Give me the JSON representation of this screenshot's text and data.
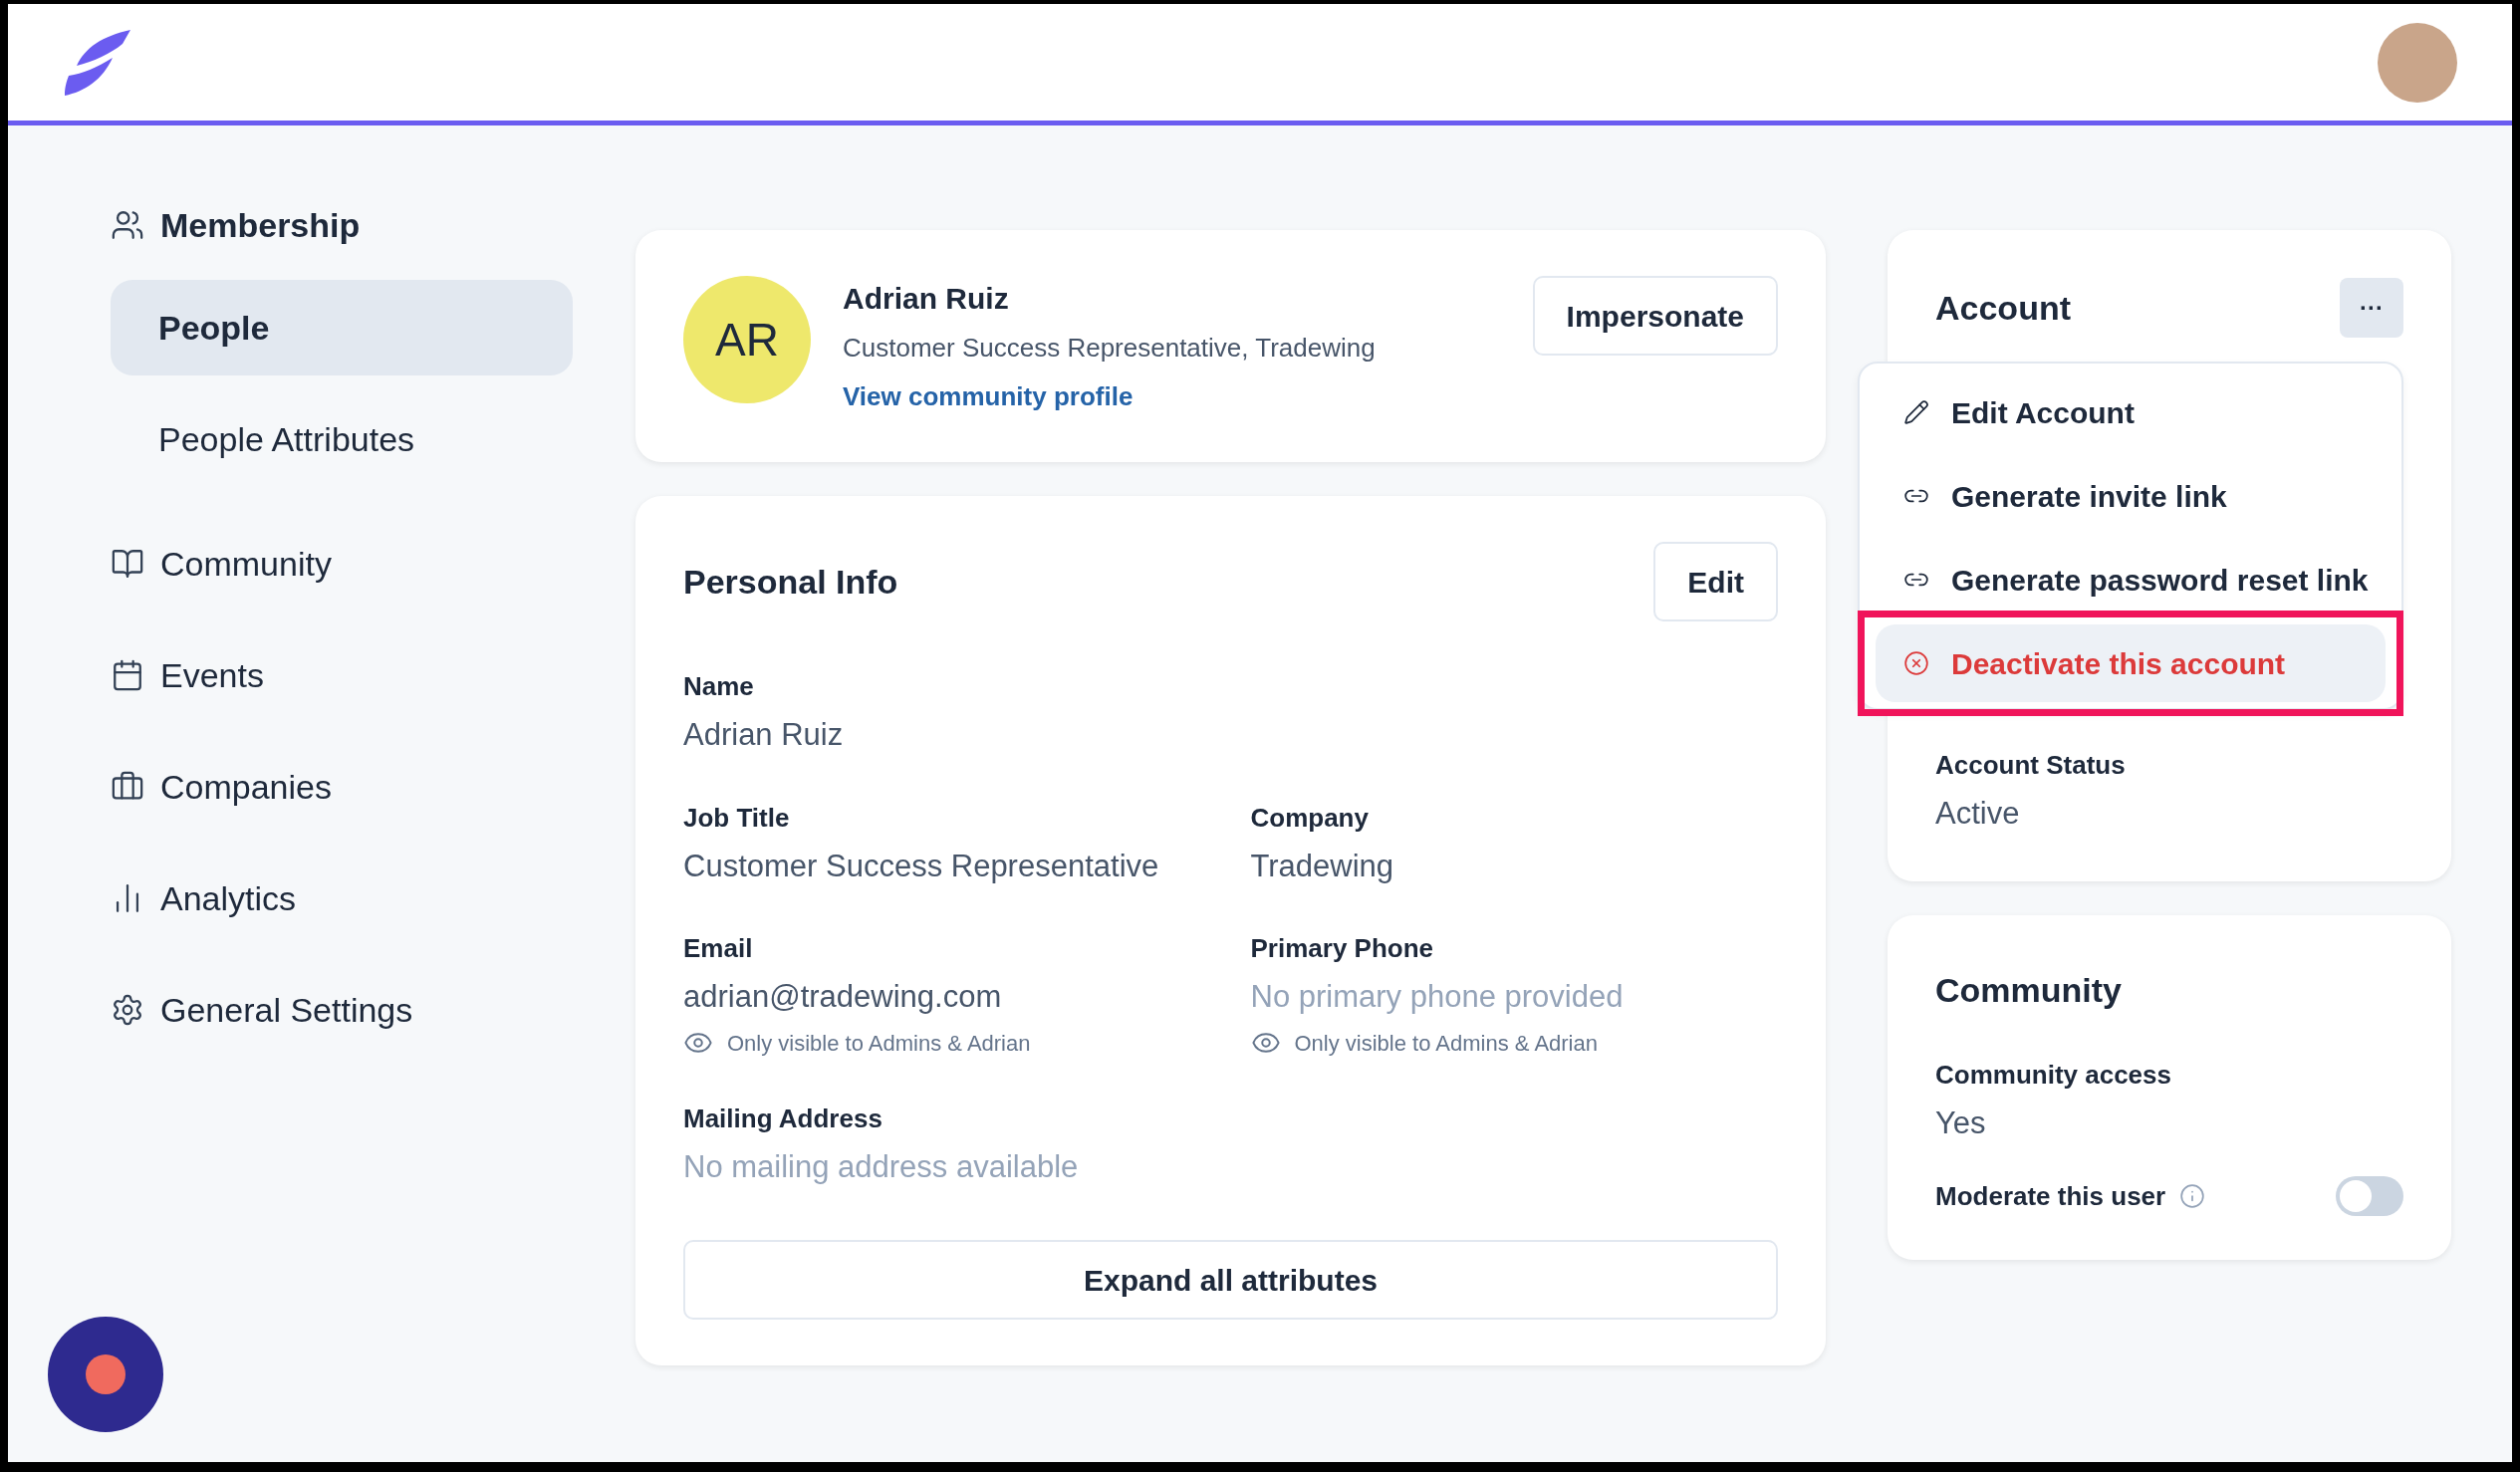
{
  "sidebar": {
    "items": [
      {
        "label": "Membership",
        "selected": false,
        "children": [
          {
            "label": "People",
            "selected": true
          },
          {
            "label": "People Attributes",
            "selected": false
          }
        ]
      },
      {
        "label": "Community",
        "selected": false
      },
      {
        "label": "Events",
        "selected": false
      },
      {
        "label": "Companies",
        "selected": false
      },
      {
        "label": "Analytics",
        "selected": false
      },
      {
        "label": "General Settings",
        "selected": false
      }
    ]
  },
  "profile": {
    "initials": "AR",
    "name": "Adrian Ruiz",
    "subtitle": "Customer Success Representative, Tradewing",
    "link": "View community profile",
    "button": "Impersonate"
  },
  "personal_info": {
    "title": "Personal Info",
    "edit_button": "Edit",
    "rows": [
      [
        {
          "label": "Name",
          "value": "Adrian Ruiz",
          "empty": false
        }
      ],
      [
        {
          "label": "Job Title",
          "value": "Customer Success Representative",
          "empty": false
        },
        {
          "label": "Company",
          "value": "Tradewing",
          "empty": false
        }
      ],
      [
        {
          "label": "Email",
          "value": "adrian@tradewing.com",
          "empty": false,
          "note": "Only visible to Admins & Adrian"
        },
        {
          "label": "Primary Phone",
          "value": "No primary phone provided",
          "empty": true,
          "note": "Only visible to Admins & Adrian"
        }
      ],
      [
        {
          "label": "Mailing Address",
          "value": "No mailing address available",
          "empty": true
        }
      ]
    ],
    "expand_button": "Expand all attributes"
  },
  "account": {
    "title": "Account",
    "more_button": "···",
    "menu": [
      {
        "label": "Edit Account",
        "kind": "edit",
        "selected": false,
        "danger": false,
        "annotated": false
      },
      {
        "label": "Generate invite link",
        "kind": "link",
        "selected": false,
        "danger": false,
        "annotated": false
      },
      {
        "label": "Generate password reset link",
        "kind": "link",
        "selected": false,
        "danger": false,
        "annotated": false
      },
      {
        "label": "Deactivate this account",
        "kind": "remove",
        "selected": true,
        "danger": true,
        "annotated": true
      }
    ],
    "status_label": "Account Status",
    "status_value": "Active"
  },
  "community": {
    "title": "Community",
    "access_label": "Community access",
    "access_value": "Yes",
    "moderate_label": "Moderate this user",
    "moderate_on": false
  }
}
